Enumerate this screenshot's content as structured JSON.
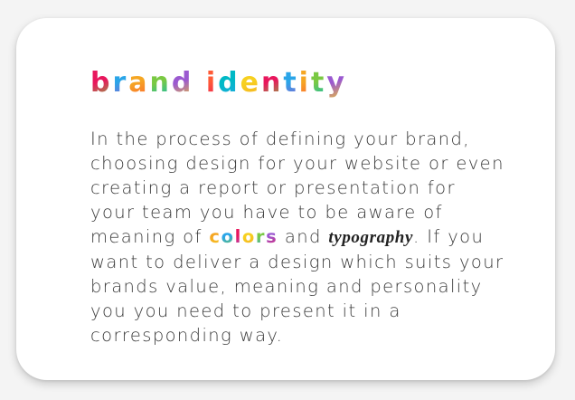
{
  "card": {
    "title": "brand identity",
    "paragraph": {
      "intro": "In the process of defining your brand, choosing design for your website or even creating a report or presentation for your team you have to be aware of meaning of",
      "colors_word": "colors",
      "connector": "and",
      "typography_word": "typography",
      "outro": ". If you want to deliver a design which suits your brands value, meaning and personality you you need to present it in a corresponding way."
    }
  },
  "colors": {
    "background": "#f4f4f4",
    "card": "#ffffff",
    "text": "#3a3a3a",
    "title_palette": [
      "#e8175d",
      "#2aa5e8",
      "#f5a623",
      "#7ac943",
      "#9b59d0",
      "#ff5a36",
      "#00b9c6",
      "#f7d020"
    ],
    "colors_word_palette": [
      "#f5a623",
      "#2aa5e8",
      "#e8175d",
      "#f7d020",
      "#7ac943",
      "#9b59d0"
    ]
  }
}
